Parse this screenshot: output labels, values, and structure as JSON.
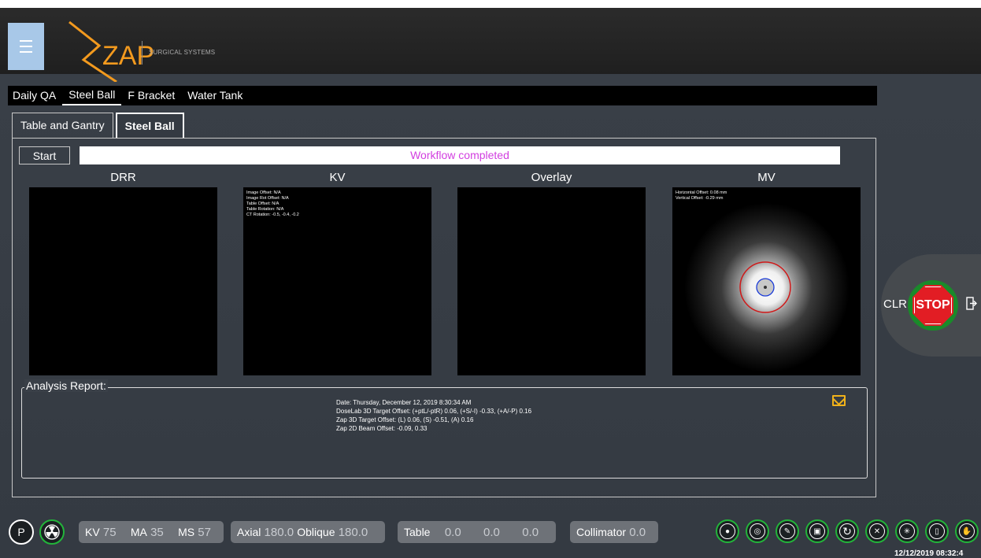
{
  "header": {
    "logo_text": "ZAP",
    "logo_subtitle": "SURGICAL SYSTEMS"
  },
  "main_tabs": [
    {
      "label": "Daily QA"
    },
    {
      "label": "Steel Ball"
    },
    {
      "label": "F Bracket"
    },
    {
      "label": "Water Tank"
    }
  ],
  "sub_tabs": [
    {
      "label": "Table and Gantry"
    },
    {
      "label": "Steel Ball"
    }
  ],
  "workflow": {
    "start_label": "Start",
    "status": "Workflow completed",
    "status_color": "#d23ee0"
  },
  "views": {
    "drr": {
      "title": "DRR"
    },
    "kv": {
      "title": "KV",
      "lines": [
        "Image Offset: N/A",
        "Image Rot Offset: N/A",
        "Table Offset: N/A",
        "Table Rotation: N/A",
        "CT Rotation: -0.5, -0.4, -0.2"
      ]
    },
    "overlay": {
      "title": "Overlay"
    },
    "mv": {
      "title": "MV",
      "lines": [
        "Horizontal Offset: 0.08 mm",
        "Vertical Offset: -0.29 mm"
      ]
    }
  },
  "analysis": {
    "label": "Analysis Report:",
    "lines": [
      "Date: Thursday, December 12, 2019 8:30:34 AM",
      "DoseLab 3D Target Offset: (+ptL/-ptR) 0.06, (+S/-I) -0.33, (+A/-P) 0.16",
      "Zap 3D Target Offset: (L) 0.06, (S) -0.51, (A) 0.16",
      "Zap 2D Beam Offset: -0.09, 0.33"
    ],
    "mail_icon": "mail-icon"
  },
  "stop_panel": {
    "clr_label": "CLR",
    "stop_label": "STOP",
    "exit_icon": "exit-icon"
  },
  "bottom_bar": {
    "p_label": "P",
    "radiation_icon": "radiation-icon",
    "kv_label": "KV",
    "kv_value": "75",
    "ma_label": "MA",
    "ma_value": "35",
    "ms_label": "MS",
    "ms_value": "57",
    "axial_label": "Axial",
    "axial_value": "180.0",
    "oblique_label": "Oblique",
    "oblique_value": "180.0",
    "table_label": "Table",
    "table_values": [
      "0.0",
      "0.0",
      "0.0"
    ],
    "collimator_label": "Collimator",
    "collimator_value": "0.0",
    "tools": [
      "head-icon",
      "target-icon",
      "pen-icon",
      "camera-icon",
      "refresh-icon",
      "satellite-icon",
      "crosshair-icon",
      "door-icon",
      "hand-icon"
    ],
    "timestamp": "12/12/2019 08:32:4"
  },
  "colors": {
    "accent_green": "#22b53a",
    "stop_red": "#e21d24",
    "logo_orange": "#f39a1e",
    "mail_gold": "#f1b21a"
  }
}
